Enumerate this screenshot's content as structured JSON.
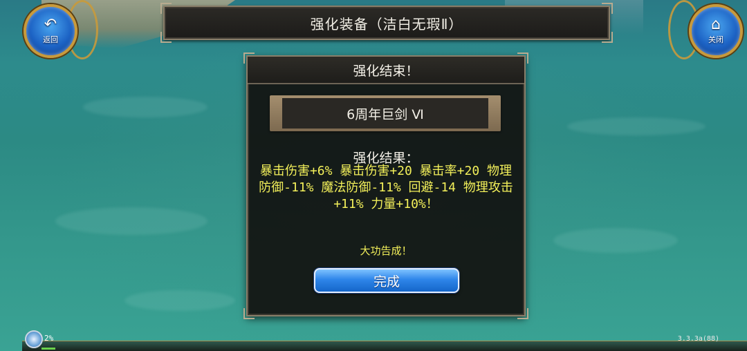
{
  "header": {
    "title": "强化装备（洁白无瑕Ⅱ）",
    "back_icon": "↶",
    "back_label": "返回",
    "close_icon": "⌂",
    "close_label": "关闭"
  },
  "dialog": {
    "title": "强化结束！",
    "item_name": "6周年巨剑 Ⅵ",
    "result_heading": "强化结果：",
    "result_text": "暴击伤害+6% 暴击伤害+20 暴击率+20 物理防御-11% 魔法防御-11% 回避-14 物理攻击+11% 力量+10%！",
    "success_text": "大功告成！",
    "done_label": "完成"
  },
  "status": {
    "progress_percent": "2%",
    "progress_value": 0.02,
    "version": "3.3.3a(88)"
  },
  "colors": {
    "accent_gold": "#c89a3c",
    "result_yellow": "#f3f05a",
    "button_blue": "#2f86ea"
  }
}
